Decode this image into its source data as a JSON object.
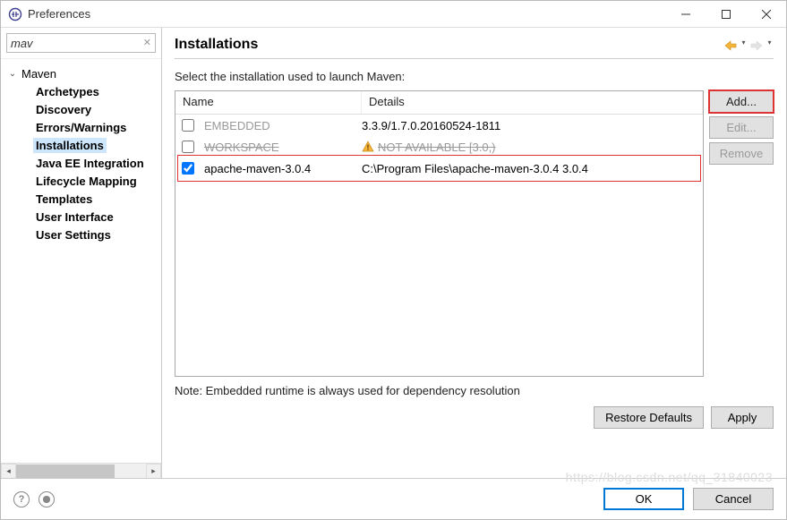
{
  "window": {
    "title": "Preferences"
  },
  "filter": {
    "value": "mav"
  },
  "tree": {
    "parent": "Maven",
    "items": [
      "Archetypes",
      "Discovery",
      "Errors/Warnings",
      "Installations",
      "Java EE Integration",
      "Lifecycle Mapping",
      "Templates",
      "User Interface",
      "User Settings"
    ],
    "selected_index": 3
  },
  "page": {
    "heading": "Installations",
    "description": "Select the installation used to launch Maven:",
    "columns": {
      "name": "Name",
      "details": "Details"
    },
    "rows": [
      {
        "checked": false,
        "disabled": false,
        "name": "EMBEDDED",
        "details": "3.3.9/1.7.0.20160524-1811",
        "warn": false,
        "dim": true
      },
      {
        "checked": false,
        "disabled": true,
        "name": "WORKSPACE",
        "details": "NOT AVAILABLE [3.0,)",
        "warn": true,
        "dim": false
      },
      {
        "checked": true,
        "disabled": false,
        "name": "apache-maven-3.0.4",
        "details": "C:\\Program Files\\apache-maven-3.0.4 3.0.4",
        "warn": false,
        "dim": false
      }
    ],
    "buttons": {
      "add": "Add...",
      "edit": "Edit...",
      "remove": "Remove"
    },
    "note": "Note: Embedded runtime is always used for dependency resolution",
    "restore": "Restore Defaults",
    "apply": "Apply"
  },
  "footer": {
    "ok": "OK",
    "cancel": "Cancel"
  },
  "watermark": "https://blog.csdn.net/qq_31840023"
}
